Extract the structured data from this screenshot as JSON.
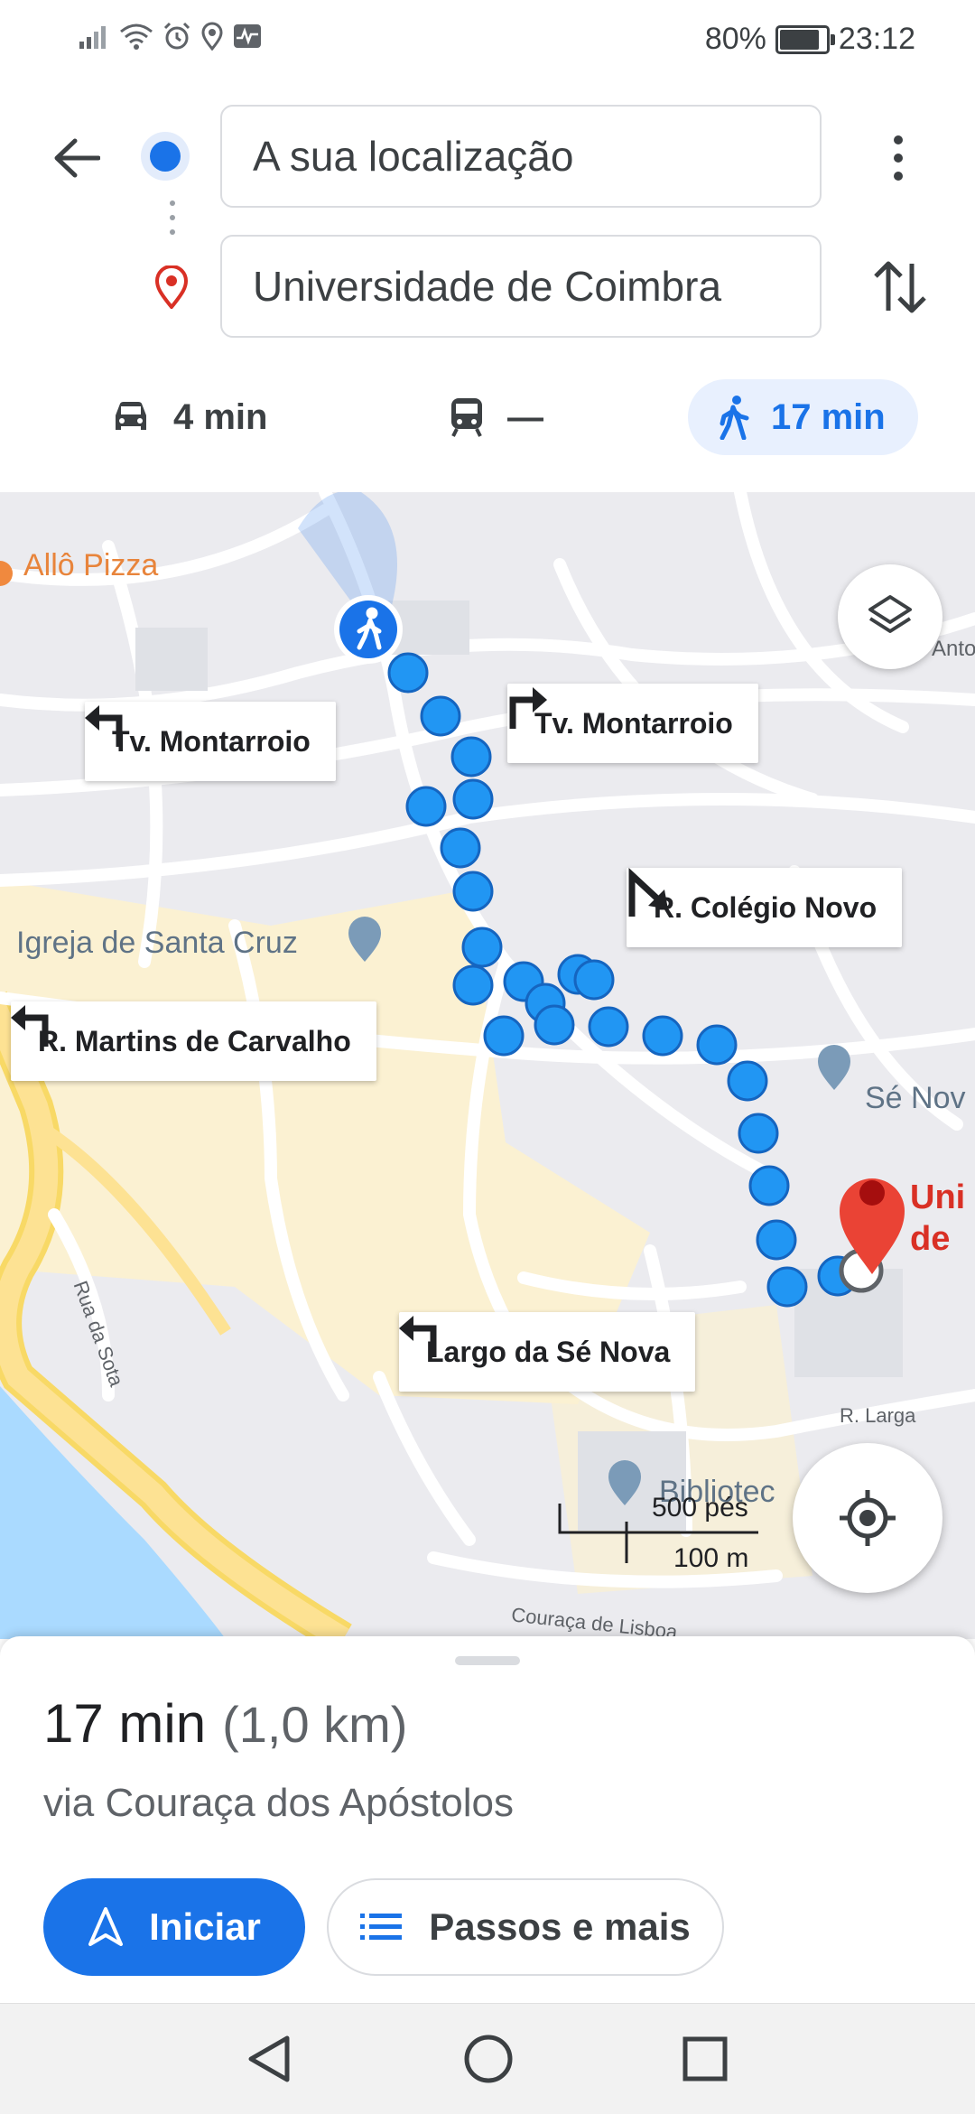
{
  "status_bar": {
    "battery_percent": "80%",
    "time": "23:12",
    "battery_level": 0.8
  },
  "search": {
    "origin_value": "A sua localização",
    "destination_value": "Universidade de Coimbra"
  },
  "modes": [
    {
      "name": "car",
      "label": "4 min",
      "icon": "car-icon"
    },
    {
      "name": "transit",
      "label": "—",
      "icon": "train-icon"
    },
    {
      "name": "walk",
      "label": "17 min",
      "icon": "walk-icon",
      "selected": true
    }
  ],
  "map": {
    "places": {
      "pizza": "Allô Pizza",
      "church": "Igreja de Santa Cruz",
      "cathedral": "Sé Nov",
      "destination": "Uni\nde",
      "library": "Bibliotec",
      "anto": "Anto"
    },
    "streets": {
      "rua_da_sota": "Rua da Sota",
      "r_larga": "R. Larga",
      "couraca": "Couraça de Lisboa"
    },
    "turns": [
      {
        "direction": "left",
        "label": "Tv. Montarroio"
      },
      {
        "direction": "right",
        "label": "Tv. Montarroio"
      },
      {
        "direction": "slight-right",
        "label": "R. Colégio Novo"
      },
      {
        "direction": "left",
        "label": "R. Martins de Carvalho"
      },
      {
        "direction": "left",
        "label": "Largo da Sé Nova"
      }
    ],
    "scale_feet": "500 pés",
    "scale_meters": "100 m"
  },
  "route_summary": {
    "duration": "17 min",
    "distance": "(1,0 km)",
    "via": "via Couraça dos Apóstolos"
  },
  "actions": {
    "start_label": "Iniciar",
    "steps_label": "Passos e mais"
  },
  "colors": {
    "accent": "#1a73e8",
    "pin_red": "#ea4335",
    "route_dot": "#2196f3"
  }
}
